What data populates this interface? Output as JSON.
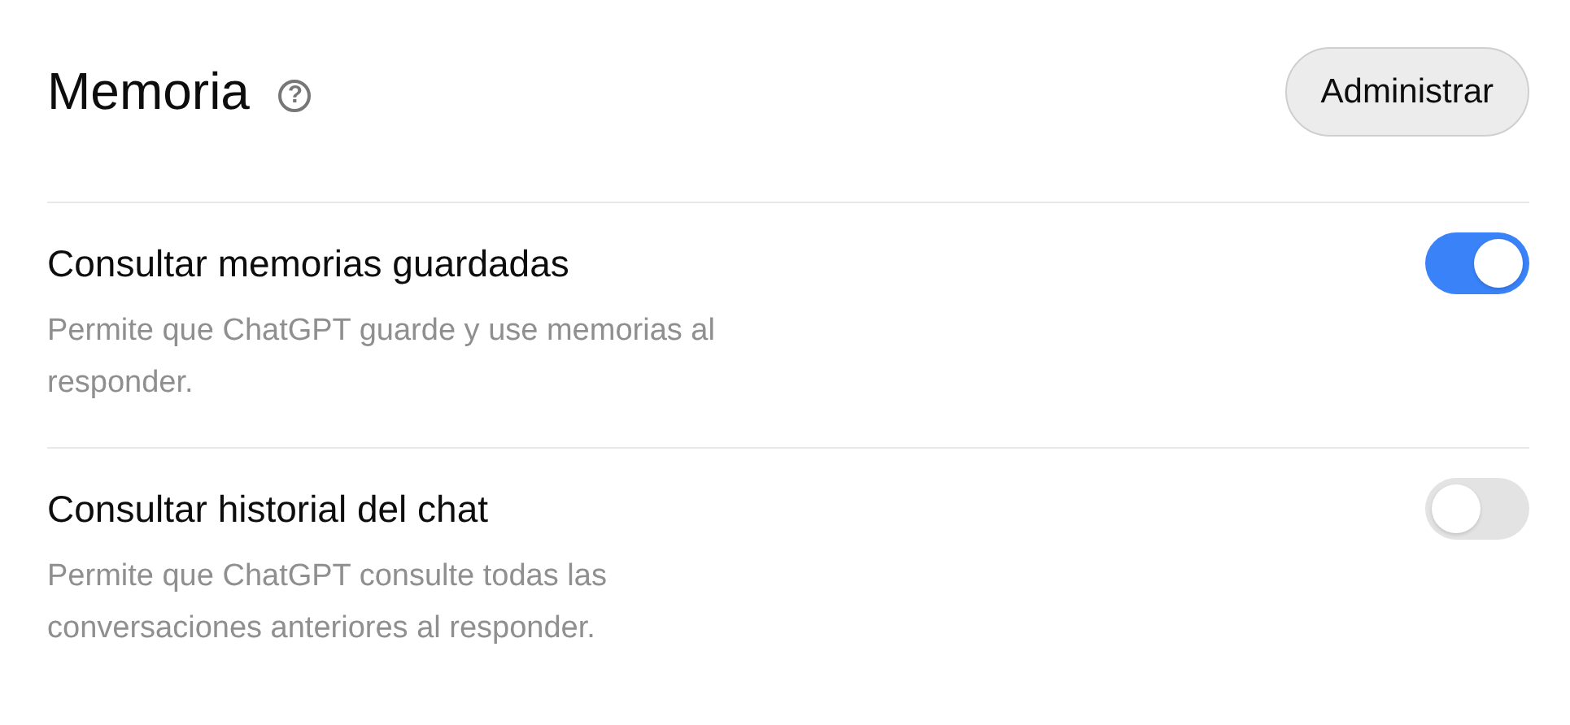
{
  "title": "Memoria",
  "help_icon": "?",
  "manage_button": "Administrar",
  "settings": [
    {
      "label": "Consultar memorias guardadas",
      "description": "Permite que ChatGPT guarde y use memorias al responder.",
      "on": true
    },
    {
      "label": "Consultar historial del chat",
      "description": "Permite que ChatGPT consulte todas las conversaciones anteriores al responder.",
      "on": false
    }
  ]
}
